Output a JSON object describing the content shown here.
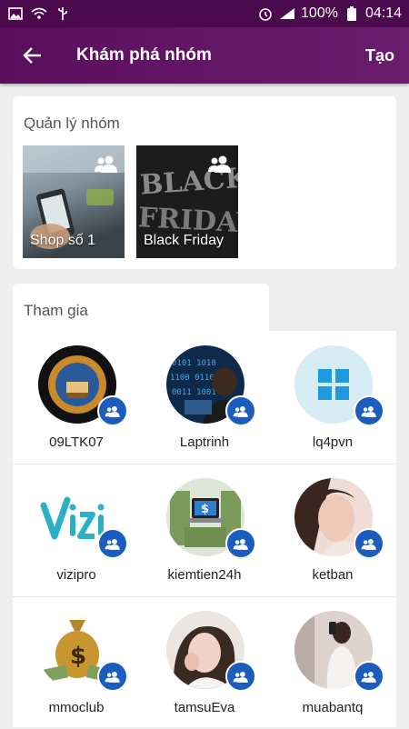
{
  "status_bar": {
    "battery": "100%",
    "time": "04:14",
    "icons": [
      "image-icon",
      "wifi-icon",
      "usb-icon",
      "alarm-icon",
      "signal-icon",
      "battery-icon"
    ]
  },
  "app_bar": {
    "title": "Khám phá nhóm",
    "create_label": "Tạo",
    "back_icon": "arrow-left-icon"
  },
  "manage": {
    "title": "Quản lý nhóm",
    "groups": [
      {
        "label": "Shop số 1",
        "icon": "group-icon"
      },
      {
        "label": "Black Friday",
        "icon": "group-icon"
      }
    ]
  },
  "join": {
    "title": "Tham gia",
    "groups": [
      {
        "name": "09LTK07"
      },
      {
        "name": "Laptrinh"
      },
      {
        "name": "lq4pvn"
      },
      {
        "name": "vizipro"
      },
      {
        "name": "kiemtien24h"
      },
      {
        "name": "ketban"
      },
      {
        "name": "mmoclub"
      },
      {
        "name": "tamsuEva"
      },
      {
        "name": "muabantq"
      }
    ]
  },
  "colors": {
    "appbar": "#5a0f5d",
    "statusbar": "#4a0a4d",
    "badge": "#1a5dbf",
    "background": "#eeeeee"
  }
}
